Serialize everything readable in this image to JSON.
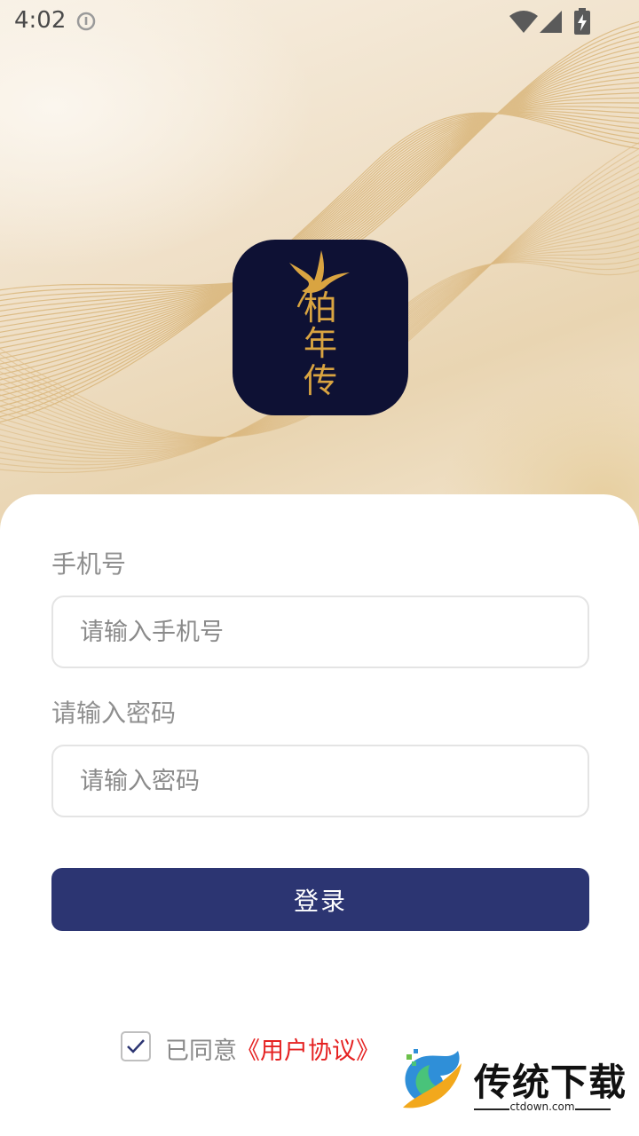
{
  "status_bar": {
    "time": "4:02"
  },
  "logo": {
    "text_lines": [
      "柏",
      "年",
      "传"
    ],
    "icon": "crane-icon",
    "background_color": "#0e1134",
    "glyph_color": "#d9a441"
  },
  "form": {
    "phone_label": "手机号",
    "phone_placeholder": "请输入手机号",
    "phone_value": "",
    "password_label": "请输入密码",
    "password_placeholder": "请输入密码",
    "password_value": "",
    "login_label": "登录"
  },
  "agreement": {
    "checked": true,
    "prefix": "已同意",
    "link_text": "《用户协议》"
  },
  "watermark": {
    "title": "传统下载",
    "url": "ctdown.com"
  },
  "colors": {
    "accent": "#2c3572",
    "link": "#e52222",
    "label": "#8f8f8f"
  }
}
